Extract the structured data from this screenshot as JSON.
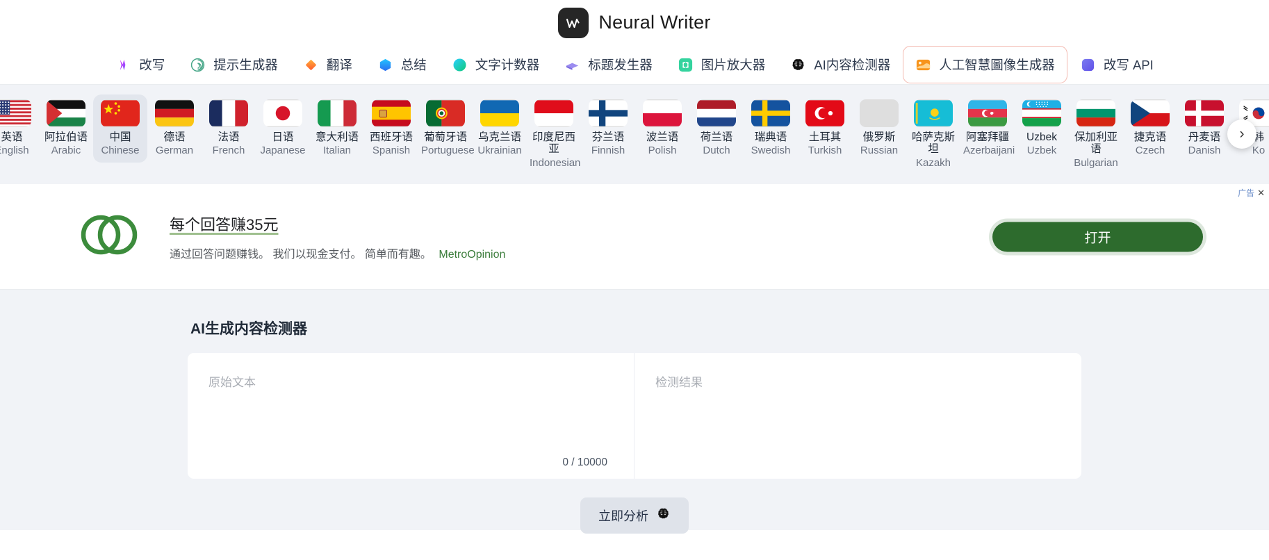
{
  "brand": {
    "name": "Neural Writer",
    "logo_icon": "neural-writer-w-logo"
  },
  "nav": {
    "items": [
      {
        "label": "改写",
        "icon": "rewrite-icon"
      },
      {
        "label": "提示生成器",
        "icon": "openai-swirl-icon"
      },
      {
        "label": "翻译",
        "icon": "translate-diamond-icon"
      },
      {
        "label": "总结",
        "icon": "summary-hexagon-icon"
      },
      {
        "label": "文字计数器",
        "icon": "word-counter-circle-icon"
      },
      {
        "label": "标题发生器",
        "icon": "title-generator-icon"
      },
      {
        "label": "图片放大器",
        "icon": "image-upscaler-icon"
      },
      {
        "label": "AI内容检测器",
        "icon": "ai-brain-icon"
      },
      {
        "label": "人工智慧圖像生成器",
        "icon": "image-generator-icon",
        "active": true
      },
      {
        "label": "改写 API",
        "icon": "api-square-icon"
      }
    ],
    "active_border_color": "#f3b9b0"
  },
  "languages": {
    "next_label": "›",
    "selected": "Chinese",
    "items": [
      {
        "cn": "英语",
        "en": "English",
        "flag": "us"
      },
      {
        "cn": "阿拉伯语",
        "en": "Arabic",
        "flag": "ps"
      },
      {
        "cn": "中国",
        "en": "Chinese",
        "flag": "cn"
      },
      {
        "cn": "德语",
        "en": "German",
        "flag": "de"
      },
      {
        "cn": "法语",
        "en": "French",
        "flag": "fr"
      },
      {
        "cn": "日语",
        "en": "Japanese",
        "flag": "jp"
      },
      {
        "cn": "意大利语",
        "en": "Italian",
        "flag": "it"
      },
      {
        "cn": "西班牙语",
        "en": "Spanish",
        "flag": "es"
      },
      {
        "cn": "葡萄牙语",
        "en": "Portuguese",
        "flag": "pt"
      },
      {
        "cn": "乌克兰语",
        "en": "Ukrainian",
        "flag": "ua"
      },
      {
        "cn": "印度尼西亚",
        "en": "Indonesian",
        "flag": "id"
      },
      {
        "cn": "芬兰语",
        "en": "Finnish",
        "flag": "fi"
      },
      {
        "cn": "波兰语",
        "en": "Polish",
        "flag": "pl"
      },
      {
        "cn": "荷兰语",
        "en": "Dutch",
        "flag": "nl"
      },
      {
        "cn": "瑞典语",
        "en": "Swedish",
        "flag": "se"
      },
      {
        "cn": "土耳其",
        "en": "Turkish",
        "flag": "tr"
      },
      {
        "cn": "俄罗斯",
        "en": "Russian",
        "flag": "blank"
      },
      {
        "cn": "哈萨克斯坦",
        "en": "Kazakh",
        "flag": "kz"
      },
      {
        "cn": "阿塞拜疆",
        "en": "Azerbaijani",
        "flag": "az"
      },
      {
        "cn": "Uzbek",
        "en": "Uzbek",
        "flag": "uz"
      },
      {
        "cn": "保加利亚语",
        "en": "Bulgarian",
        "flag": "bg"
      },
      {
        "cn": "捷克语",
        "en": "Czech",
        "flag": "cz"
      },
      {
        "cn": "丹麦语",
        "en": "Danish",
        "flag": "dk"
      },
      {
        "cn": "韩",
        "en": "Ko",
        "flag": "kr"
      }
    ]
  },
  "ad": {
    "label": "广告",
    "close_icon": "close-icon",
    "title": "每个回答赚35元",
    "description": "通过回答问题赚钱。 我们以现金支付。 简单而有趣。",
    "brand": "MetroOpinion",
    "cta_label": "打开",
    "cta_color": "#2d6b2d",
    "logo_icon": "metroopinion-rings-logo"
  },
  "main": {
    "title": "AI生成内容检测器",
    "source_placeholder": "原始文本",
    "source_value": "",
    "result_placeholder": "检测结果",
    "counter": "0 / 10000",
    "analyze_label": "立即分析",
    "analyze_icon": "ai-brain-icon"
  }
}
